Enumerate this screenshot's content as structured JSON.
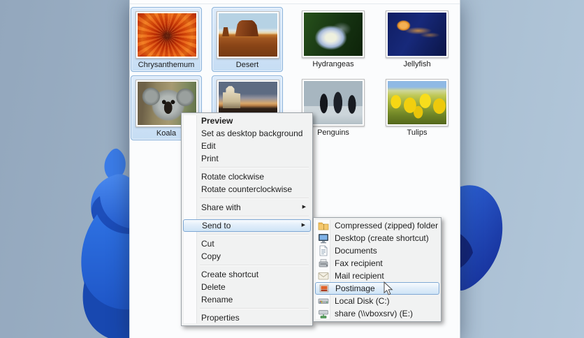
{
  "window": {
    "items": [
      {
        "label": "Chrysanthemum",
        "selected": true
      },
      {
        "label": "Desert",
        "selected": true
      },
      {
        "label": "Hydrangeas",
        "selected": false
      },
      {
        "label": "Jellyfish",
        "selected": false
      },
      {
        "label": "Koala",
        "selected": true
      },
      {
        "label": "",
        "selected": true
      },
      {
        "label": "Penguins",
        "selected": false
      },
      {
        "label": "Tulips",
        "selected": false
      }
    ]
  },
  "context_menu": {
    "items": [
      {
        "label": "Preview",
        "bold": true
      },
      {
        "label": "Set as desktop background"
      },
      {
        "label": "Edit"
      },
      {
        "label": "Print"
      },
      {
        "label": "Rotate clockwise"
      },
      {
        "label": "Rotate counterclockwise"
      },
      {
        "label": "Share with",
        "has_submenu": true
      },
      {
        "label": "Send to",
        "has_submenu": true,
        "highlighted": true
      },
      {
        "label": "Cut"
      },
      {
        "label": "Copy"
      },
      {
        "label": "Create shortcut"
      },
      {
        "label": "Delete"
      },
      {
        "label": "Rename"
      },
      {
        "label": "Properties"
      }
    ]
  },
  "send_to_submenu": {
    "items": [
      {
        "label": "Compressed (zipped) folder",
        "icon": "zipped-folder-icon"
      },
      {
        "label": "Desktop (create shortcut)",
        "icon": "desktop-icon"
      },
      {
        "label": "Documents",
        "icon": "documents-icon"
      },
      {
        "label": "Fax recipient",
        "icon": "fax-icon"
      },
      {
        "label": "Mail recipient",
        "icon": "mail-icon"
      },
      {
        "label": "Postimage",
        "icon": "postimage-icon",
        "highlighted": true
      },
      {
        "label": "Local Disk (C:)",
        "icon": "local-disk-icon"
      },
      {
        "label": "share (\\\\vboxsrv) (E:)",
        "icon": "network-drive-icon"
      }
    ]
  },
  "colors": {
    "selection_fill": "#cde0f5",
    "selection_border": "#86b0da",
    "menu_background": "#f1f2f2",
    "menu_highlight_border": "#7fa8d4",
    "wallpaper_blue": "#2d63d6"
  }
}
